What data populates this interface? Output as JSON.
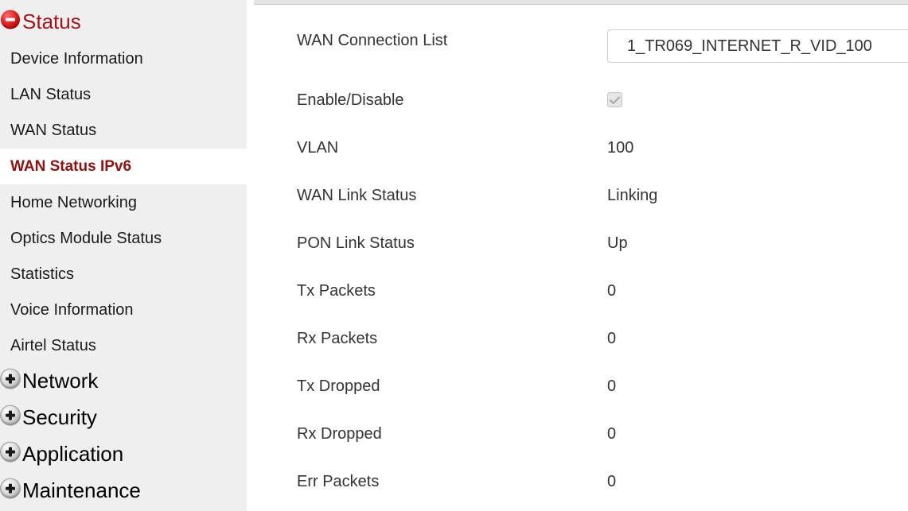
{
  "sidebar": {
    "status_section": {
      "label": "Status",
      "state": "expanded",
      "icon": "minus-circle-icon"
    },
    "status_items": [
      {
        "label": "Device Information"
      },
      {
        "label": "LAN Status"
      },
      {
        "label": "WAN Status"
      },
      {
        "label": "WAN Status IPv6",
        "active": true
      },
      {
        "label": "Home Networking"
      },
      {
        "label": "Optics Module Status"
      },
      {
        "label": "Statistics"
      },
      {
        "label": "Voice Information"
      },
      {
        "label": "Airtel Status"
      }
    ],
    "collapsed_sections": [
      {
        "label": "Network",
        "icon": "plus-circle-icon"
      },
      {
        "label": "Security",
        "icon": "plus-circle-icon"
      },
      {
        "label": "Application",
        "icon": "plus-circle-icon"
      },
      {
        "label": "Maintenance",
        "icon": "plus-circle-icon"
      }
    ]
  },
  "main": {
    "wan_connection_list": {
      "label": "WAN Connection List",
      "selected": "1_TR069_INTERNET_R_VID_100"
    },
    "enable_disable": {
      "label": "Enable/Disable",
      "checked": true,
      "disabled": true
    },
    "rows": [
      {
        "label": "VLAN",
        "value": "100"
      },
      {
        "label": "WAN Link Status",
        "value": "Linking"
      },
      {
        "label": "PON Link Status",
        "value": "Up"
      },
      {
        "label": "Tx Packets",
        "value": "0"
      },
      {
        "label": "Rx Packets",
        "value": "0"
      },
      {
        "label": "Tx Dropped",
        "value": "0"
      },
      {
        "label": "Rx Dropped",
        "value": "0"
      },
      {
        "label": "Err Packets",
        "value": "0"
      }
    ]
  },
  "colors": {
    "sidebar_bg": "#efefef",
    "active_text": "#8e1212",
    "section_open_text": "#a0141a",
    "text": "#333333"
  }
}
